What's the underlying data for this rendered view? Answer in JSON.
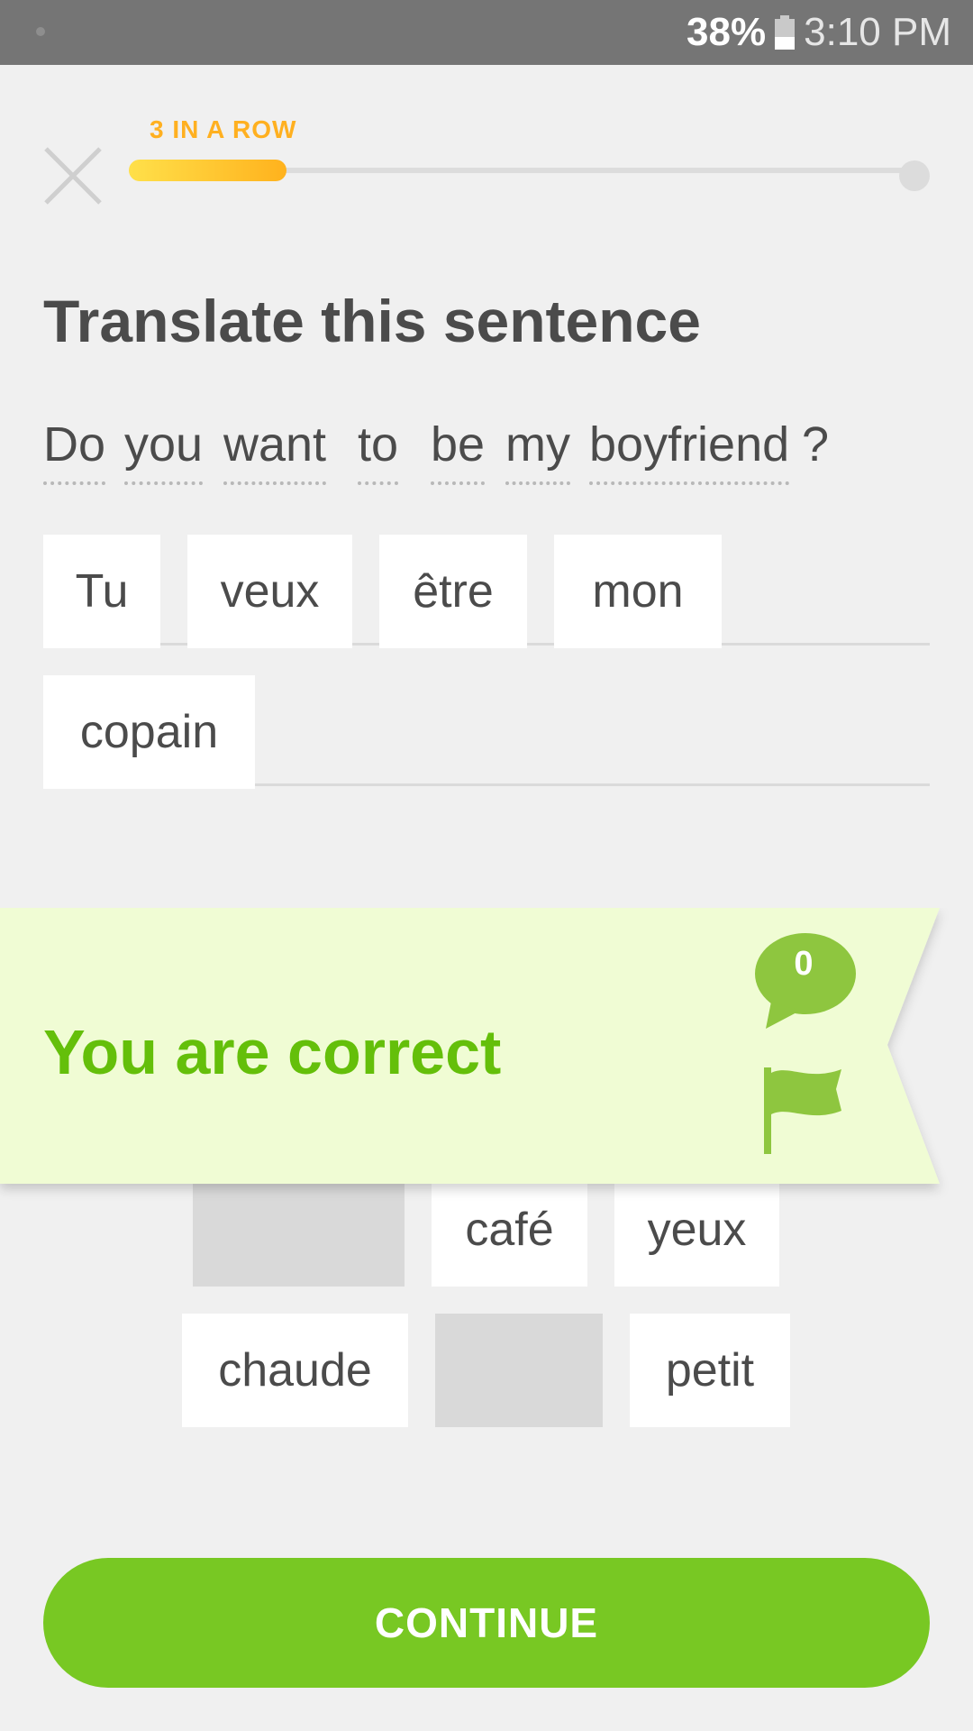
{
  "status_bar": {
    "battery_percent": "38%",
    "time": "3:10 PM"
  },
  "header": {
    "streak_label": "3 IN A ROW",
    "progress_fraction": 0.2
  },
  "exercise": {
    "title": "Translate this sentence",
    "prompt_words": [
      "Do",
      "you",
      "want",
      "to",
      "be",
      "my",
      "boyfriend"
    ],
    "prompt_punct": "?",
    "answer_tiles": [
      "Tu",
      "veux",
      "être",
      "mon",
      "copain"
    ]
  },
  "word_bank": {
    "tiles": [
      "",
      "café",
      "yeux",
      "chaude",
      "",
      "petit"
    ]
  },
  "feedback": {
    "message": "You are correct",
    "discussion_count": "0"
  },
  "continue_label": "CONTINUE",
  "colors": {
    "accent_green": "#78c823",
    "correct_text": "#64bf0a",
    "banner_bg": "#f0fcd4",
    "streak_orange": "#ffb020"
  }
}
